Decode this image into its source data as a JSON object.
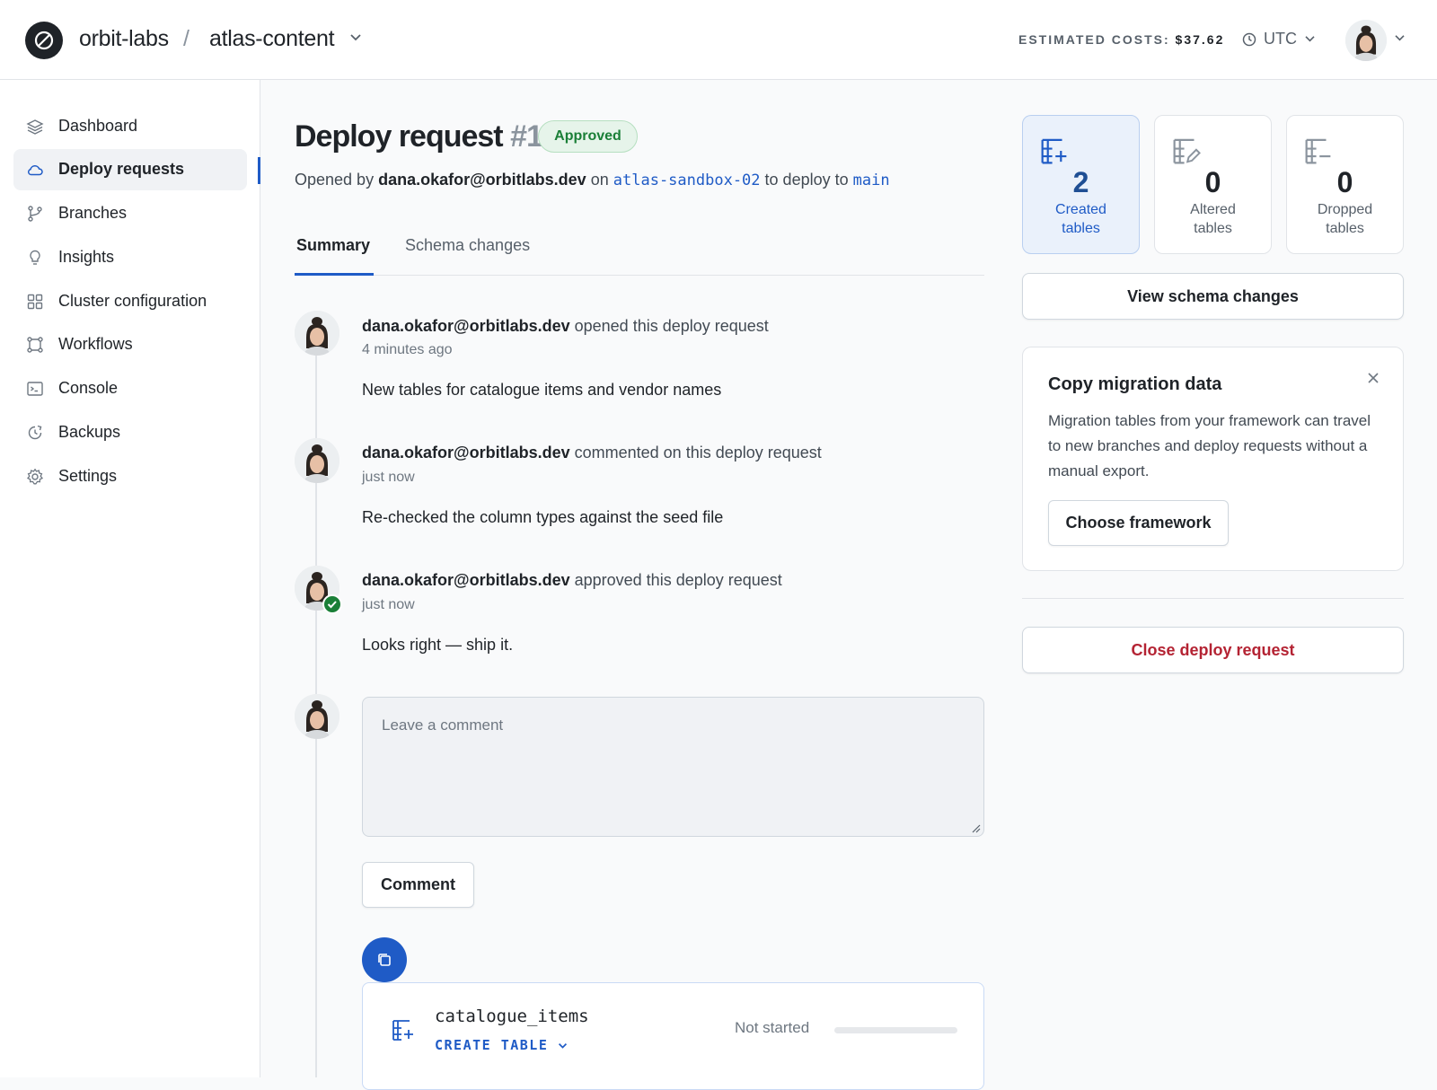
{
  "header": {
    "org": "orbit-labs",
    "separator": "/",
    "database": "atlas-content",
    "costs_label": "ESTIMATED COSTS:",
    "costs_value": "$37.62",
    "timezone": "UTC"
  },
  "sidebar": {
    "items": [
      {
        "label": "Dashboard",
        "icon": "layers-icon"
      },
      {
        "label": "Deploy requests",
        "icon": "cloud-icon"
      },
      {
        "label": "Branches",
        "icon": "git-branch-icon"
      },
      {
        "label": "Insights",
        "icon": "lightbulb-icon"
      },
      {
        "label": "Cluster configuration",
        "icon": "grid-icon"
      },
      {
        "label": "Workflows",
        "icon": "workflow-icon"
      },
      {
        "label": "Console",
        "icon": "terminal-icon"
      },
      {
        "label": "Backups",
        "icon": "backup-clock-icon"
      },
      {
        "label": "Settings",
        "icon": "gear-icon"
      }
    ],
    "active": "Deploy requests"
  },
  "request": {
    "title": "Deploy request",
    "number": "#1",
    "status": "Approved",
    "opened_prefix": "Opened by",
    "author": "dana.okafor@orbitlabs.dev",
    "on_word": "on",
    "source_branch": "atlas-sandbox-02",
    "deploy_to_text": "to deploy to",
    "target_branch": "main"
  },
  "tabs": [
    {
      "label": "Summary",
      "active": true
    },
    {
      "label": "Schema changes",
      "active": false
    }
  ],
  "timeline": [
    {
      "author": "dana.okafor@orbitlabs.dev",
      "action": "opened this deploy request",
      "time": "4 minutes ago",
      "body": "New tables for catalogue items and vendor names"
    },
    {
      "author": "dana.okafor@orbitlabs.dev",
      "action": "commented on this deploy request",
      "time": "just now",
      "body": "Re-checked the column types against the seed file"
    },
    {
      "author": "dana.okafor@orbitlabs.dev",
      "action": "approved this deploy request",
      "time": "just now",
      "body": "Looks right — ship it."
    }
  ],
  "comment": {
    "placeholder": "Leave a comment",
    "button": "Comment"
  },
  "deploy_table": {
    "name": "catalogue_items",
    "action": "CREATE TABLE",
    "status": "Not started",
    "progress": 0
  },
  "stats": [
    {
      "value": "2",
      "label1": "Created",
      "label2": "tables",
      "icon": "table-add-icon",
      "selected": true
    },
    {
      "value": "0",
      "label1": "Altered",
      "label2": "tables",
      "icon": "table-edit-icon",
      "selected": false
    },
    {
      "value": "0",
      "label1": "Dropped",
      "label2": "tables",
      "icon": "table-remove-icon",
      "selected": false
    }
  ],
  "view_schema_button": "View schema changes",
  "migration": {
    "title": "Copy migration data",
    "text": "Migration tables from your framework can travel to new branches and deploy requests without a manual export.",
    "button": "Choose framework"
  },
  "close_button": "Close deploy request",
  "colors": {
    "accent": "#1f5bc6",
    "approved": "#1a7f37",
    "danger": "#b42333"
  }
}
